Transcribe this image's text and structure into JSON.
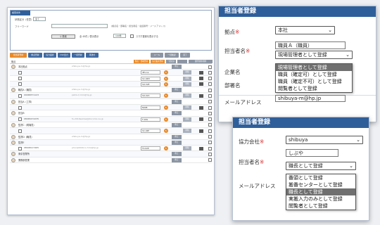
{
  "list_window": {
    "search": {
      "box_title": "検索条件",
      "labels": {
        "status": "状態区分（任意）",
        "free_word": "フリーワード",
        "search_btn": "検索"
      },
      "status_value": "全て",
      "hint": "(拠点名・部署名・担当者名・電話番号・メールアドレス)",
      "count_text": "全 45件 / 表示表示",
      "per_page": "100件",
      "note": "スマホ登録を表示する"
    },
    "toolbar": [
      "担当者登録",
      "拠点登録",
      "協力業者",
      "CSV出力",
      "一括登録",
      "再送付",
      "メール",
      "一括確認",
      "完了"
    ],
    "table": {
      "header_label": "拠点",
      "header_buttons": [
        "拠点・部署登録",
        "協力業者登録",
        "一括表示",
        "",
        "選択削除/削除"
      ]
    },
    "rows": [
      {
        "kind": "org",
        "name": "本社拠点",
        "mail": "shibuya-m@hp.jp",
        "tel": "",
        "btn": "修正"
      },
      {
        "kind": "user",
        "name": "",
        "mail": "",
        "tel": "iPhone",
        "btn": "削除"
      },
      {
        "kind": "user",
        "name": "",
        "mail": "",
        "tel": "SC-02M",
        "btn": "削除"
      },
      {
        "kind": "user",
        "name": "",
        "mail": "",
        "tel": "SO-52E",
        "btn": "削除"
      },
      {
        "kind": "org",
        "name": "職員A（職員）",
        "mail": "shibuya-m@hp.jp",
        "tel": "",
        "btn": "修正"
      },
      {
        "kind": "user",
        "name": "09068371123",
        "mail": "ps01-m.hmi@hp.jp",
        "tel": "SO-02C",
        "btn": "削除"
      },
      {
        "kind": "org",
        "name": "担当A（工事）",
        "mail": "",
        "tel": "",
        "btn": "修正"
      },
      {
        "kind": "user",
        "name": "",
        "mail": "",
        "tel": "N908",
        "btn": "削除"
      },
      {
        "kind": "org",
        "name": "担当B",
        "mail": "",
        "tel": "",
        "btn": "修正"
      },
      {
        "kind": "user",
        "name": "08065472235",
        "mail": "fu-2019samsa@docomo.ne.jp",
        "tel": "F-02G",
        "btn": "削除"
      },
      {
        "kind": "org",
        "name": "監督C（現場員）",
        "mail": "",
        "tel": "",
        "btn": "修正"
      },
      {
        "kind": "user",
        "name": "",
        "mail": "",
        "tel": "SC-04E",
        "btn": "削除"
      },
      {
        "kind": "org",
        "name": "監督D（職員）",
        "mail": "shibuya-m@hp.jp",
        "tel": "",
        "btn": "修正"
      },
      {
        "kind": "org",
        "name": "監督E",
        "mail": "",
        "tel": "",
        "btn": "修正"
      },
      {
        "kind": "user",
        "name": "08048117465",
        "mail": "phone0006-lu.hmi@hp.jp",
        "tel": "F2-02E",
        "btn": "削除"
      },
      {
        "kind": "org",
        "name": "東京営業所",
        "mail": "",
        "tel": "",
        "btn": "修正"
      },
      {
        "kind": "org",
        "name": "業務部営業",
        "mail": "",
        "tel": "",
        "btn": "修正"
      }
    ]
  },
  "popup1": {
    "title": "担当者登録",
    "labels": {
      "base": "拠点",
      "person": "担当者名",
      "company": "企業名",
      "dept": "部署名",
      "email": "メールアドレス"
    },
    "req": "※",
    "base_value": "本社",
    "person_value": "職員Ａ（職員）",
    "role_selected": "現場管理者として登録",
    "role_options": [
      "現場管理者として登録",
      "職員（確定可）として登録",
      "職員（確定不可）として登録",
      "閲覧者として登録"
    ],
    "role_highlight": 0,
    "email_value": "shibuya-m@hp.jp"
  },
  "popup2": {
    "title": "担当者登録",
    "labels": {
      "company": "協力会社",
      "person": "担当者名",
      "email": "メールアドレス"
    },
    "req": "※",
    "company_value": "shibuya",
    "person_value": "しぶや",
    "role_selected": "職長として登録",
    "role_options": [
      "番頭として登録",
      "搬番センターとして登録",
      "職長として登録",
      "実搬入力のみとして登録",
      "閲覧者として登録"
    ],
    "role_highlight": 2
  },
  "colors": {
    "header_blue": "#2f5f9a",
    "accent_orange": "#e88a2a",
    "highlight_gray": "#6f6f6f"
  }
}
